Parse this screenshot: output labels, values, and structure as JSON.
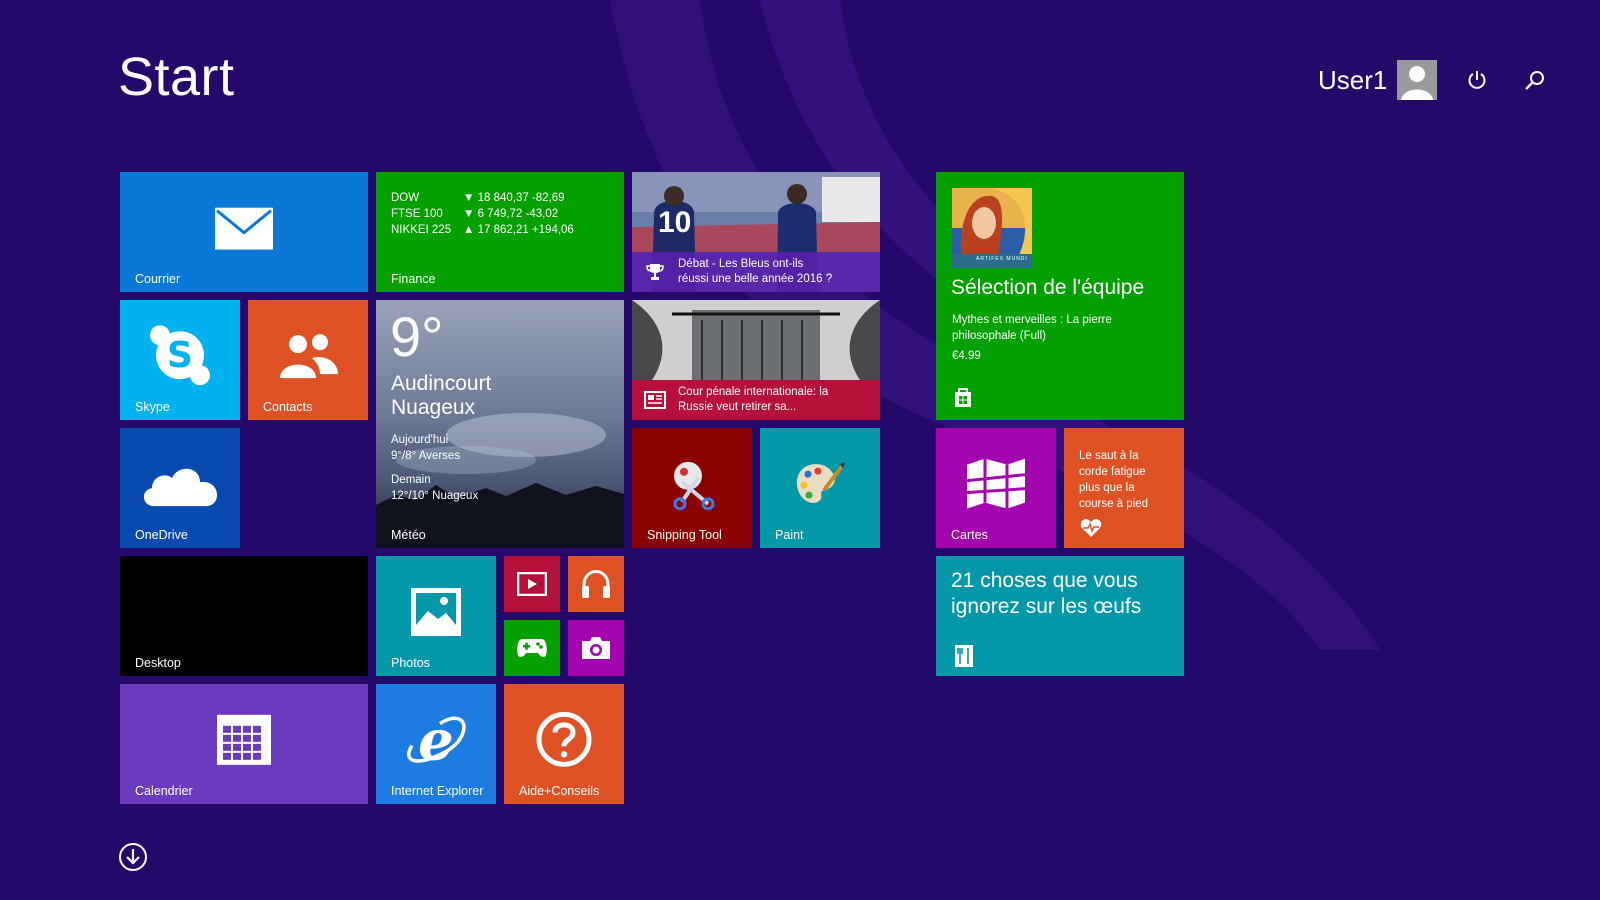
{
  "header": {
    "title": "Start",
    "user_name": "User1"
  },
  "tiles": {
    "mail": {
      "label": "Courrier"
    },
    "finance": {
      "label": "Finance",
      "rows": [
        {
          "name": "DOW",
          "value": "▼ 18 840,37 -82,69"
        },
        {
          "name": "FTSE 100",
          "value": "▼ 6 749,72 -43,02"
        },
        {
          "name": "NIKKEI 225",
          "value": "▲ 17 862,21 +194,06"
        }
      ]
    },
    "sport": {
      "line1": "Débat - Les Bleus ont-ils",
      "line2": "réussi une belle année 2016 ?",
      "jersey_number": "10"
    },
    "store": {
      "title": "Sélection de l'équipe",
      "subtitle_line1": "Mythes et merveilles : La pierre",
      "subtitle_line2": "philosophale (Full)",
      "price": "€4.99",
      "art_caption": "ARTIFEX MUNDI"
    },
    "skype": {
      "label": "Skype"
    },
    "contacts": {
      "label": "Contacts"
    },
    "weather": {
      "label": "Météo",
      "temp": "9°",
      "city": "Audincourt",
      "condition": "Nuageux",
      "today_label": "Aujourd'hui",
      "today_forecast": "9°/8° Averses",
      "tomorrow_label": "Demain",
      "tomorrow_forecast": "12°/10° Nuageux"
    },
    "news": {
      "line1": "Cour pénale internationale: la",
      "line2": "Russie veut retirer sa..."
    },
    "onedrive": {
      "label": "OneDrive"
    },
    "snipping": {
      "label": "Snipping Tool"
    },
    "paint": {
      "label": "Paint"
    },
    "maps": {
      "label": "Cartes"
    },
    "health": {
      "line1": "Le saut à la",
      "line2": "corde fatigue",
      "line3": "plus que la",
      "line4": "course à pied"
    },
    "desktop": {
      "label": "Desktop"
    },
    "photos": {
      "label": "Photos"
    },
    "food": {
      "line1": "21 choses que vous",
      "line2": "ignorez sur les œufs"
    },
    "calendar": {
      "label": "Calendrier"
    },
    "ie": {
      "label": "Internet Explorer"
    },
    "help": {
      "label": "Aide+Conseils"
    }
  },
  "colors": {
    "background": "#24096a",
    "blue": "#0a78d7",
    "green": "#03a000",
    "orange": "#dd5124",
    "skype": "#00b1f0",
    "onedrive": "#094ab1",
    "dark_red": "#8b0000",
    "teal": "#0297a9",
    "magenta": "#a403b0",
    "crimson": "#b5113a",
    "purple": "#6b3bbf",
    "ie_blue": "#1d7ce2"
  },
  "icons": [
    "mail-icon",
    "skype-icon",
    "contacts-icon",
    "onedrive-icon",
    "trophy-icon",
    "newspaper-icon",
    "scissors-icon",
    "palette-icon",
    "maps-icon",
    "heart-pulse-icon",
    "store-bag-icon",
    "photo-icon",
    "video-icon",
    "headphones-icon",
    "gamepad-icon",
    "camera-icon",
    "calendar-icon",
    "ie-icon",
    "help-icon",
    "cutlery-icon",
    "power-icon",
    "search-icon",
    "arrow-down-icon",
    "user-avatar-icon"
  ]
}
